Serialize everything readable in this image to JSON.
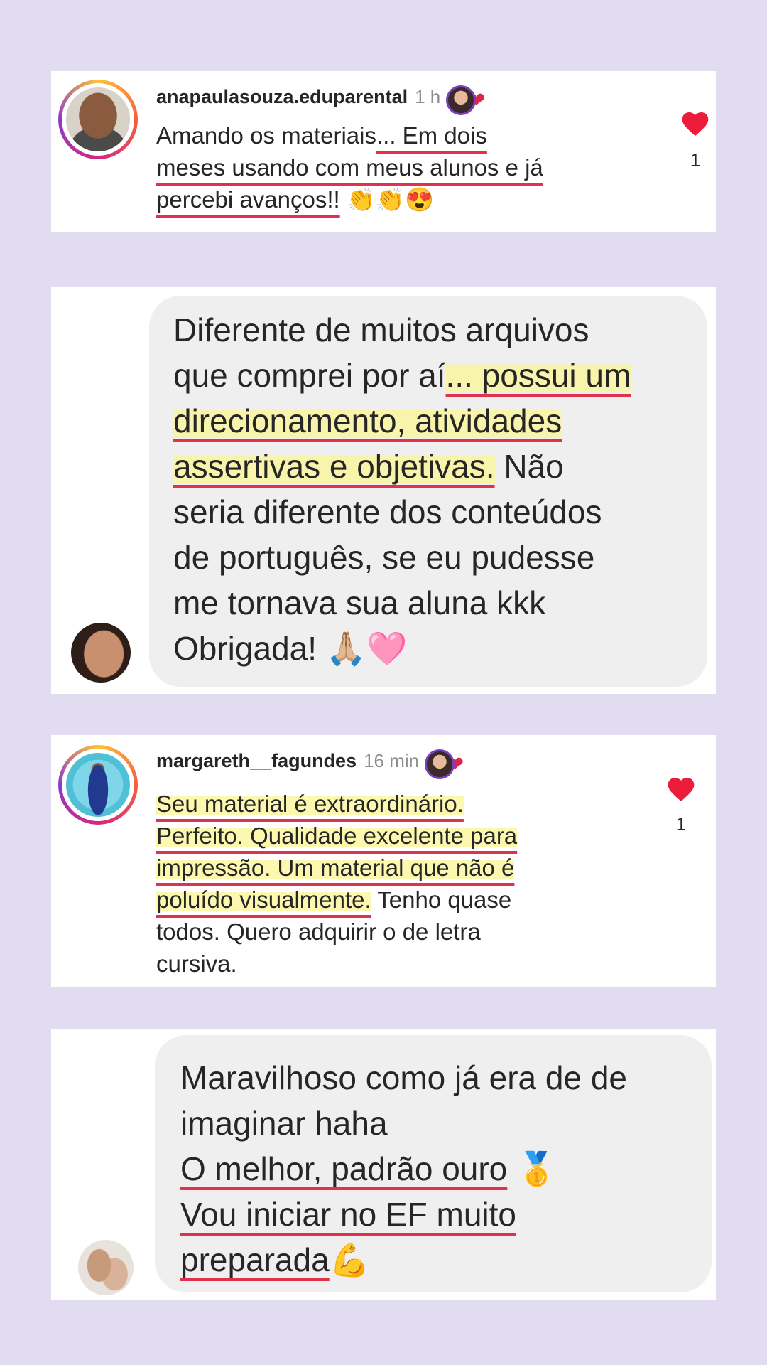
{
  "comment1": {
    "username": "anapaulasouza.eduparental",
    "time": "1 h",
    "lines": [
      [
        "Amando os materiais",
        "... Em dois"
      ],
      [
        "meses usando com meus alunos e já",
        ""
      ],
      [
        "percebi avanços!!",
        " 👏👏😍"
      ]
    ],
    "likes": "1"
  },
  "bubble1": {
    "lines": [
      "Diferente de muitos arquivos",
      [
        "que comprei por aí",
        "... possui um"
      ],
      "direcionamento, atividades",
      [
        "assertivas e objetivas.",
        " Não"
      ],
      "seria diferente dos conteúdos",
      "de português, se eu pudesse",
      "me tornava sua aluna kkk",
      "Obrigada! 🙏🏼🩷"
    ]
  },
  "comment2": {
    "username": "margareth__fagundes",
    "time": "16 min",
    "lines": [
      "Seu material é extraordinário.",
      "Perfeito.  Qualidade excelente para",
      "impressão. Um material que não é",
      [
        "poluído visualmente.",
        "  Tenho quase"
      ],
      "todos. Quero adquirir o de letra",
      "cursiva."
    ],
    "likes": "1"
  },
  "bubble2": {
    "lines": [
      "Maravilhoso como já era de de",
      "imaginar haha",
      [
        "O melhor, padrão ouro",
        " 🥇"
      ],
      "Vou iniciar no EF muito",
      [
        "preparada",
        "💪"
      ]
    ]
  },
  "colors": {
    "background": "#e2dcf0",
    "underline": "#e0334b",
    "highlight": "#fcf696",
    "heart": "#ed1c3a",
    "bubble": "#efefef"
  }
}
